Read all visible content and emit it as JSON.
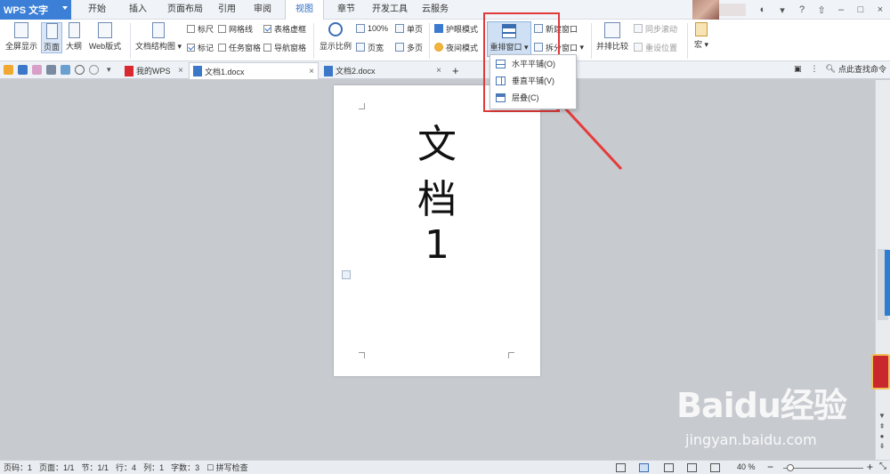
{
  "menubar": {
    "app_name": "WPS 文字",
    "tabs": [
      "开始",
      "插入",
      "页面布局",
      "引用",
      "审阅",
      "视图",
      "章节",
      "开发工具",
      "云服务"
    ],
    "active_tab": "视图",
    "window_controls": [
      "?",
      "–",
      "□",
      "×"
    ]
  },
  "ribbon": {
    "views": [
      "全屏显示",
      "页面",
      "大纲",
      "Web版式"
    ],
    "doc_map": "文档结构图",
    "checks": [
      {
        "label": "标尺",
        "checked": false
      },
      {
        "label": "网格线",
        "checked": false
      },
      {
        "label": "表格虚框",
        "checked": true
      },
      {
        "label": "标记",
        "checked": true
      },
      {
        "label": "任务窗格",
        "checked": false
      },
      {
        "label": "导航窗格",
        "checked": false
      }
    ],
    "zoom_ratio": "显示比例",
    "zoom_100": "100%",
    "page_width": "页宽",
    "single_page": "单页",
    "multi_page": "多页",
    "eye_mode": "护眼模式",
    "night_mode": "夜间模式",
    "rearrange": "重排窗口",
    "new_window": "新建窗口",
    "split_window": "拆分窗口",
    "side_by_side": "并排比较",
    "sync_scroll": "同步滚动",
    "reset_position": "重设位置",
    "macro": "宏"
  },
  "tabstrip": {
    "tabs": [
      {
        "label": "我的WPS",
        "active": false
      },
      {
        "label": "文档1.docx",
        "active": true
      },
      {
        "label": "文档2.docx",
        "active": false
      }
    ],
    "add": "+",
    "search": "点此查找命令"
  },
  "dropdown": {
    "items": [
      "水平平铺(O)",
      "垂直平铺(V)",
      "层叠(C)"
    ]
  },
  "document": {
    "lines": [
      "文",
      "档",
      "1"
    ]
  },
  "statusbar": {
    "page_code": "页码：1",
    "pages": "页面：1/1",
    "section": "节：1/1",
    "row": "行：4",
    "column": "列：1",
    "word_count": "字数：3",
    "spell_check": "拼写检查",
    "zoom": "40 %",
    "zoom_minus": "−",
    "zoom_plus": "+"
  },
  "watermark": {
    "brand": "Baidu经验",
    "url": "jingyan.baidu.com"
  }
}
